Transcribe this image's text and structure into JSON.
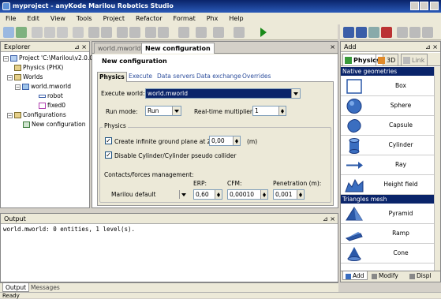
{
  "window": {
    "title": "myproject - anyKode Marilou Robotics Studio"
  },
  "menu": [
    "File",
    "Edit",
    "View",
    "Tools",
    "Project",
    "Refactor",
    "Format",
    "Phx",
    "Help"
  ],
  "explorer": {
    "title": "Explorer",
    "items": [
      {
        "label": "Project 'C:\\Marilou\\v2.0.0",
        "level": 0
      },
      {
        "label": "Physics (PHX)",
        "level": 1
      },
      {
        "label": "Worlds",
        "level": 1
      },
      {
        "label": "world.mworld",
        "level": 2
      },
      {
        "label": "robot",
        "level": 3
      },
      {
        "label": "fixed0",
        "level": 3
      },
      {
        "label": "Configurations",
        "level": 1
      },
      {
        "label": "New configuration",
        "level": 2
      }
    ]
  },
  "document": {
    "tabs": [
      "world.mworld",
      "New configuration"
    ],
    "heading": "New configuration",
    "subtabs": [
      "Physics",
      "Execute",
      "Data servers",
      "Data exchange",
      "Overrides"
    ],
    "execute_world_label": "Execute world:",
    "execute_world_value": "world.mworld",
    "run_mode_label": "Run mode:",
    "run_mode_value": "Run",
    "realtime_label": "Real-time multiplier:",
    "realtime_value": "1",
    "physics_group": "Physics",
    "ground_plane_label": "Create infinite ground plane at Z=",
    "ground_plane_value": "0,00",
    "ground_plane_unit": "(m)",
    "disable_collider_label": "Disable Cylinder/Cylinder pseudo collider",
    "contacts_label": "Contacts/forces management:",
    "erp_label": "ERP:",
    "cfm_label": "CFM:",
    "penetration_label": "Penetration (m):",
    "contacts_value": "Marilou default",
    "erp_value": "0,60",
    "cfm_value": "0,00010",
    "penetration_value": "0,001"
  },
  "output": {
    "title": "Output",
    "text": "world.mworld: 0 entities, 1 level(s).",
    "tabs": [
      "Output",
      "Messages"
    ]
  },
  "add": {
    "title": "Add",
    "tabs": [
      "Physics",
      "3D",
      "Link"
    ],
    "sections": [
      {
        "title": "Native geometries",
        "items": [
          "Box",
          "Sphere",
          "Capsule",
          "Cylinder",
          "Ray",
          "Height field"
        ]
      },
      {
        "title": "Triangles mesh",
        "items": [
          "Pyramid",
          "Ramp",
          "Cone"
        ]
      }
    ],
    "bottom_tabs": [
      "Add",
      "Modify",
      "Displ"
    ]
  },
  "status": "Ready"
}
